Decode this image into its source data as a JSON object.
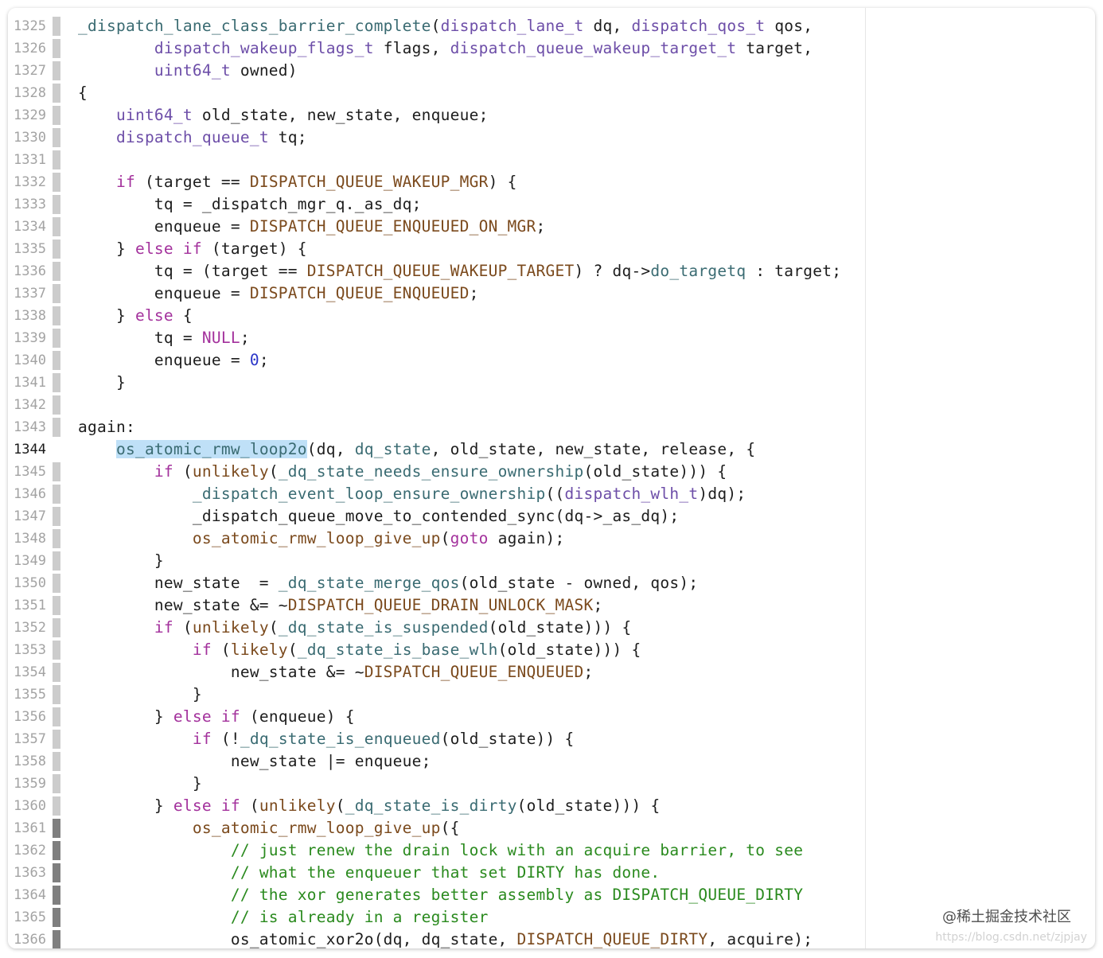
{
  "colors": {
    "plain": "#1d1d1d",
    "function": "#3a6b72",
    "type": "#6d4ea8",
    "keyword": "#a3319c",
    "macro": "#7b4a1d",
    "number": "#2a35c8",
    "comment": "#2a8a1e",
    "selection": "#bfe0f7",
    "strip_gray": "#cccccc",
    "strip_dark": "#7f7f7f"
  },
  "editor": {
    "current_line": "1344",
    "lines": [
      {
        "no": "1325",
        "strip": "gray",
        "tokens": [
          [
            "_dispatch_lane_class_barrier_complete",
            "fn"
          ],
          [
            "(",
            "p"
          ],
          [
            "dispatch_lane_t",
            "type"
          ],
          [
            " dq, ",
            "p"
          ],
          [
            "dispatch_qos_t",
            "type"
          ],
          [
            " qos,",
            "p"
          ]
        ]
      },
      {
        "no": "1326",
        "strip": "gray",
        "tokens": [
          [
            "        ",
            "p"
          ],
          [
            "dispatch_wakeup_flags_t",
            "type"
          ],
          [
            " flags, ",
            "p"
          ],
          [
            "dispatch_queue_wakeup_target_t",
            "type"
          ],
          [
            " target,",
            "p"
          ]
        ]
      },
      {
        "no": "1327",
        "strip": "gray",
        "tokens": [
          [
            "        ",
            "p"
          ],
          [
            "uint64_t",
            "type"
          ],
          [
            " owned)",
            "p"
          ]
        ]
      },
      {
        "no": "1328",
        "strip": "gray",
        "tokens": [
          [
            "{",
            "p"
          ]
        ]
      },
      {
        "no": "1329",
        "strip": "gray",
        "tokens": [
          [
            "    ",
            "p"
          ],
          [
            "uint64_t",
            "type"
          ],
          [
            " old_state, new_state, enqueue;",
            "p"
          ]
        ]
      },
      {
        "no": "1330",
        "strip": "gray",
        "tokens": [
          [
            "    ",
            "p"
          ],
          [
            "dispatch_queue_t",
            "type"
          ],
          [
            " tq;",
            "p"
          ]
        ]
      },
      {
        "no": "1331",
        "strip": "gray",
        "tokens": []
      },
      {
        "no": "1332",
        "strip": "gray",
        "tokens": [
          [
            "    ",
            "p"
          ],
          [
            "if",
            "kw"
          ],
          [
            " (target == ",
            "p"
          ],
          [
            "DISPATCH_QUEUE_WAKEUP_MGR",
            "macro"
          ],
          [
            ") {",
            "p"
          ]
        ]
      },
      {
        "no": "1333",
        "strip": "gray",
        "tokens": [
          [
            "        tq = _dispatch_mgr_q._as_dq;",
            "p"
          ]
        ]
      },
      {
        "no": "1334",
        "strip": "gray",
        "tokens": [
          [
            "        enqueue = ",
            "p"
          ],
          [
            "DISPATCH_QUEUE_ENQUEUED_ON_MGR",
            "macro"
          ],
          [
            ";",
            "p"
          ]
        ]
      },
      {
        "no": "1335",
        "strip": "gray",
        "tokens": [
          [
            "    } ",
            "p"
          ],
          [
            "else",
            "kw"
          ],
          [
            " ",
            "p"
          ],
          [
            "if",
            "kw"
          ],
          [
            " (target) {",
            "p"
          ]
        ]
      },
      {
        "no": "1336",
        "strip": "gray",
        "tokens": [
          [
            "        tq = (target == ",
            "p"
          ],
          [
            "DISPATCH_QUEUE_WAKEUP_TARGET",
            "macro"
          ],
          [
            ") ? dq->",
            "p"
          ],
          [
            "do_targetq",
            "fn"
          ],
          [
            " : target;",
            "p"
          ]
        ]
      },
      {
        "no": "1337",
        "strip": "gray",
        "tokens": [
          [
            "        enqueue = ",
            "p"
          ],
          [
            "DISPATCH_QUEUE_ENQUEUED",
            "macro"
          ],
          [
            ";",
            "p"
          ]
        ]
      },
      {
        "no": "1338",
        "strip": "gray",
        "tokens": [
          [
            "    } ",
            "p"
          ],
          [
            "else",
            "kw"
          ],
          [
            " {",
            "p"
          ]
        ]
      },
      {
        "no": "1339",
        "strip": "gray",
        "tokens": [
          [
            "        tq = ",
            "p"
          ],
          [
            "NULL",
            "kw"
          ],
          [
            ";",
            "p"
          ]
        ]
      },
      {
        "no": "1340",
        "strip": "gray",
        "tokens": [
          [
            "        enqueue = ",
            "p"
          ],
          [
            "0",
            "num"
          ],
          [
            ";",
            "p"
          ]
        ]
      },
      {
        "no": "1341",
        "strip": "gray",
        "tokens": [
          [
            "    }",
            "p"
          ]
        ]
      },
      {
        "no": "1342",
        "strip": "gray",
        "tokens": []
      },
      {
        "no": "1343",
        "strip": "gray",
        "tokens": [
          [
            "again:",
            "p"
          ]
        ]
      },
      {
        "no": "1344",
        "strip": "none",
        "tokens": [
          [
            "    ",
            "p"
          ],
          [
            "os_atomic_rmw_loop2o",
            "fn",
            "sel"
          ],
          [
            "(dq, ",
            "p"
          ],
          [
            "dq_state",
            "fn"
          ],
          [
            ", old_state, new_state, release, {",
            "p"
          ]
        ]
      },
      {
        "no": "1345",
        "strip": "gray",
        "tokens": [
          [
            "        ",
            "p"
          ],
          [
            "if",
            "kw"
          ],
          [
            " (",
            "p"
          ],
          [
            "unlikely",
            "macro"
          ],
          [
            "(",
            "p"
          ],
          [
            "_dq_state_needs_ensure_ownership",
            "fn"
          ],
          [
            "(old_state))) {",
            "p"
          ]
        ]
      },
      {
        "no": "1346",
        "strip": "gray",
        "tokens": [
          [
            "            ",
            "p"
          ],
          [
            "_dispatch_event_loop_ensure_ownership",
            "fn"
          ],
          [
            "((",
            "p"
          ],
          [
            "dispatch_wlh_t",
            "type"
          ],
          [
            ")dq);",
            "p"
          ]
        ]
      },
      {
        "no": "1347",
        "strip": "gray",
        "tokens": [
          [
            "            _dispatch_queue_move_to_contended_sync(dq->_as_dq);",
            "p"
          ]
        ]
      },
      {
        "no": "1348",
        "strip": "gray",
        "tokens": [
          [
            "            ",
            "p"
          ],
          [
            "os_atomic_rmw_loop_give_up",
            "macro"
          ],
          [
            "(",
            "p"
          ],
          [
            "goto",
            "kw"
          ],
          [
            " again);",
            "p"
          ]
        ]
      },
      {
        "no": "1349",
        "strip": "gray",
        "tokens": [
          [
            "        }",
            "p"
          ]
        ]
      },
      {
        "no": "1350",
        "strip": "gray",
        "tokens": [
          [
            "        new_state  = ",
            "p"
          ],
          [
            "_dq_state_merge_qos",
            "fn"
          ],
          [
            "(old_state - owned, qos);",
            "p"
          ]
        ]
      },
      {
        "no": "1351",
        "strip": "gray",
        "tokens": [
          [
            "        new_state &= ~",
            "p"
          ],
          [
            "DISPATCH_QUEUE_DRAIN_UNLOCK_MASK",
            "macro"
          ],
          [
            ";",
            "p"
          ]
        ]
      },
      {
        "no": "1352",
        "strip": "gray",
        "tokens": [
          [
            "        ",
            "p"
          ],
          [
            "if",
            "kw"
          ],
          [
            " (",
            "p"
          ],
          [
            "unlikely",
            "macro"
          ],
          [
            "(",
            "p"
          ],
          [
            "_dq_state_is_suspended",
            "fn"
          ],
          [
            "(old_state))) {",
            "p"
          ]
        ]
      },
      {
        "no": "1353",
        "strip": "gray",
        "tokens": [
          [
            "            ",
            "p"
          ],
          [
            "if",
            "kw"
          ],
          [
            " (",
            "p"
          ],
          [
            "likely",
            "macro"
          ],
          [
            "(",
            "p"
          ],
          [
            "_dq_state_is_base_wlh",
            "fn"
          ],
          [
            "(old_state))) {",
            "p"
          ]
        ]
      },
      {
        "no": "1354",
        "strip": "gray",
        "tokens": [
          [
            "                new_state &= ~",
            "p"
          ],
          [
            "DISPATCH_QUEUE_ENQUEUED",
            "macro"
          ],
          [
            ";",
            "p"
          ]
        ]
      },
      {
        "no": "1355",
        "strip": "gray",
        "tokens": [
          [
            "            }",
            "p"
          ]
        ]
      },
      {
        "no": "1356",
        "strip": "gray",
        "tokens": [
          [
            "        } ",
            "p"
          ],
          [
            "else",
            "kw"
          ],
          [
            " ",
            "p"
          ],
          [
            "if",
            "kw"
          ],
          [
            " (enqueue) {",
            "p"
          ]
        ]
      },
      {
        "no": "1357",
        "strip": "gray",
        "tokens": [
          [
            "            ",
            "p"
          ],
          [
            "if",
            "kw"
          ],
          [
            " (!",
            "p"
          ],
          [
            "_dq_state_is_enqueued",
            "fn"
          ],
          [
            "(old_state)) {",
            "p"
          ]
        ]
      },
      {
        "no": "1358",
        "strip": "gray",
        "tokens": [
          [
            "                new_state |= enqueue;",
            "p"
          ]
        ]
      },
      {
        "no": "1359",
        "strip": "gray",
        "tokens": [
          [
            "            }",
            "p"
          ]
        ]
      },
      {
        "no": "1360",
        "strip": "gray",
        "tokens": [
          [
            "        } ",
            "p"
          ],
          [
            "else",
            "kw"
          ],
          [
            " ",
            "p"
          ],
          [
            "if",
            "kw"
          ],
          [
            " (",
            "p"
          ],
          [
            "unlikely",
            "macro"
          ],
          [
            "(",
            "p"
          ],
          [
            "_dq_state_is_dirty",
            "fn"
          ],
          [
            "(old_state))) {",
            "p"
          ]
        ]
      },
      {
        "no": "1361",
        "strip": "dark",
        "tokens": [
          [
            "            ",
            "p"
          ],
          [
            "os_atomic_rmw_loop_give_up",
            "macro"
          ],
          [
            "({",
            "p"
          ]
        ]
      },
      {
        "no": "1362",
        "strip": "dark",
        "tokens": [
          [
            "                ",
            "p"
          ],
          [
            "// just renew the drain lock with an acquire barrier, to see",
            "cmt"
          ]
        ]
      },
      {
        "no": "1363",
        "strip": "dark",
        "tokens": [
          [
            "                ",
            "p"
          ],
          [
            "// what the enqueuer that set DIRTY has done.",
            "cmt"
          ]
        ]
      },
      {
        "no": "1364",
        "strip": "dark",
        "tokens": [
          [
            "                ",
            "p"
          ],
          [
            "// the xor generates better assembly as DISPATCH_QUEUE_DIRTY",
            "cmt"
          ]
        ]
      },
      {
        "no": "1365",
        "strip": "dark",
        "tokens": [
          [
            "                ",
            "p"
          ],
          [
            "// is already in a register",
            "cmt"
          ]
        ]
      },
      {
        "no": "1366",
        "strip": "dark",
        "tokens": [
          [
            "                os_atomic_xor2o(dq, dq_state, ",
            "p"
          ],
          [
            "DISPATCH_QUEUE_DIRTY",
            "macro"
          ],
          [
            ", acquire);",
            "p"
          ]
        ]
      }
    ]
  },
  "watermark": {
    "text": "@稀土掘金技术社区",
    "url": "https://blog.csdn.net/zjpjay"
  }
}
